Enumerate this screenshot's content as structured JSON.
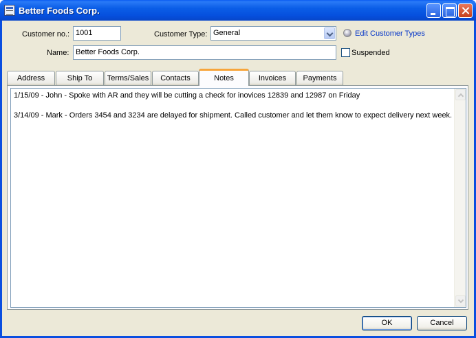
{
  "window": {
    "title": "Better Foods Corp."
  },
  "form": {
    "customer_no_label": "Customer no.:",
    "customer_no_value": "1001",
    "customer_type_label": "Customer Type:",
    "customer_type_value": "General",
    "edit_customer_types_label": "Edit Customer Types",
    "name_label": "Name:",
    "name_value": "Better Foods Corp.",
    "suspended_label": "Suspended",
    "suspended_checked": false
  },
  "tabs": [
    {
      "label": "Address"
    },
    {
      "label": "Ship To"
    },
    {
      "label": "Terms/Sales"
    },
    {
      "label": "Contacts"
    },
    {
      "label": "Notes",
      "active": true
    },
    {
      "label": "Invoices"
    },
    {
      "label": "Payments"
    }
  ],
  "notes": {
    "lines": [
      "1/15/09 - John - Spoke with AR and they will be cutting a check for inovices 12839 and 12987 on Friday",
      "3/14/09 - Mark - Orders 3454 and 3234 are delayed for shipment.  Called customer and let them know to expect delivery next week."
    ]
  },
  "buttons": {
    "ok_label": "OK",
    "cancel_label": "Cancel"
  },
  "colors": {
    "titlebar": "#0650de",
    "client_bg": "#ece9d8",
    "active_tab_accent": "#f7a53c",
    "link": "#0032c8"
  }
}
